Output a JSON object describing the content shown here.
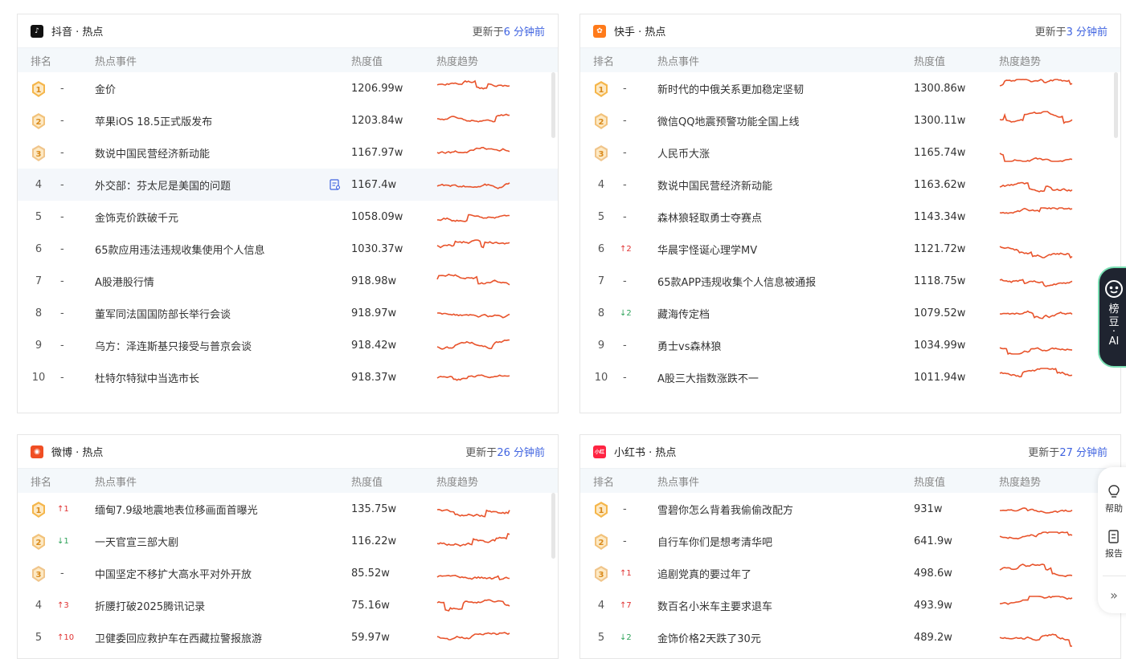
{
  "columns": {
    "rank": "排名",
    "title": "热点事件",
    "value": "热度值",
    "trend": "热度趋势"
  },
  "updated_prefix": "更新于",
  "updated_suffix": " 分钟前",
  "cards": [
    {
      "title": "抖音 · 热点",
      "updated": "6",
      "logo_icon": "douyin-logo-icon",
      "logo_color": "#111111",
      "rows": [
        {
          "rank": "1",
          "change": "-",
          "title": "金价",
          "value": "1206.99w"
        },
        {
          "rank": "2",
          "change": "-",
          "title": "苹果iOS 18.5正式版发布",
          "value": "1203.84w"
        },
        {
          "rank": "3",
          "change": "-",
          "title": "数说中国民营经济新动能",
          "value": "1167.97w"
        },
        {
          "rank": "4",
          "change": "-",
          "title": "外交部：芬太尼是美国的问题",
          "value": "1167.4w"
        },
        {
          "rank": "5",
          "change": "-",
          "title": "金饰克价跌破千元",
          "value": "1058.09w"
        },
        {
          "rank": "6",
          "change": "-",
          "title": "65款应用违法违规收集使用个人信息",
          "value": "1030.37w"
        },
        {
          "rank": "7",
          "change": "-",
          "title": "A股港股行情",
          "value": "918.98w"
        },
        {
          "rank": "8",
          "change": "-",
          "title": "董军同法国国防部长举行会谈",
          "value": "918.97w"
        },
        {
          "rank": "9",
          "change": "-",
          "title": "乌方：泽连斯基只接受与普京会谈",
          "value": "918.42w"
        },
        {
          "rank": "10",
          "change": "-",
          "title": "杜特尔特狱中当选市长",
          "value": "918.37w"
        }
      ]
    },
    {
      "title": "快手 · 热点",
      "updated": "3",
      "logo_icon": "kuaishou-logo-icon",
      "logo_color": "#ff7a1a",
      "rows": [
        {
          "rank": "1",
          "change": "-",
          "title": "新时代的中俄关系更加稳定坚韧",
          "value": "1300.86w"
        },
        {
          "rank": "2",
          "change": "-",
          "title": "微信QQ地震预警功能全国上线",
          "value": "1300.11w"
        },
        {
          "rank": "3",
          "change": "-",
          "title": "人民币大涨",
          "value": "1165.74w"
        },
        {
          "rank": "4",
          "change": "-",
          "title": "数说中国民营经济新动能",
          "value": "1163.62w"
        },
        {
          "rank": "5",
          "change": "-",
          "title": "森林狼轻取勇士夺赛点",
          "value": "1143.34w"
        },
        {
          "rank": "6",
          "change": "↑2",
          "dir": "up",
          "title": "华晨宇怪诞心理学MV",
          "value": "1121.72w"
        },
        {
          "rank": "7",
          "change": "-",
          "title": "65款APP违规收集个人信息被通报",
          "value": "1118.75w"
        },
        {
          "rank": "8",
          "change": "↓2",
          "dir": "down",
          "title": "藏海传定档",
          "value": "1079.52w"
        },
        {
          "rank": "9",
          "change": "-",
          "title": "勇士vs森林狼",
          "value": "1034.99w"
        },
        {
          "rank": "10",
          "change": "-",
          "title": "A股三大指数涨跌不一",
          "value": "1011.94w"
        }
      ]
    },
    {
      "title": "微博 · 热点",
      "updated": "26",
      "logo_icon": "weibo-logo-icon",
      "logo_color": "#f04e23",
      "rows": [
        {
          "rank": "1",
          "change": "↑1",
          "dir": "up",
          "title": "缅甸7.9级地震地表位移画面首曝光",
          "value": "135.75w"
        },
        {
          "rank": "2",
          "change": "↓1",
          "dir": "down",
          "title": "一天官宣三部大剧",
          "value": "116.22w"
        },
        {
          "rank": "3",
          "change": "-",
          "title": "中国坚定不移扩大高水平对外开放",
          "value": "85.52w"
        },
        {
          "rank": "4",
          "change": "↑3",
          "dir": "up",
          "title": "折腰打破2025腾讯记录",
          "value": "75.16w"
        },
        {
          "rank": "5",
          "change": "↑10",
          "dir": "up",
          "title": "卫健委回应救护车在西藏拉警报旅游",
          "value": "59.97w"
        }
      ]
    },
    {
      "title": "小红书 · 热点",
      "updated": "27",
      "logo_icon": "xiaohongshu-logo-icon",
      "logo_color": "#ff2442",
      "rows": [
        {
          "rank": "1",
          "change": "-",
          "title": "雪碧你怎么背着我偷偷改配方",
          "value": "931w"
        },
        {
          "rank": "2",
          "change": "-",
          "title": "自行车你们是想考清华吧",
          "value": "641.9w"
        },
        {
          "rank": "3",
          "change": "↑1",
          "dir": "up",
          "title": "追剧党真的要过年了",
          "value": "498.6w"
        },
        {
          "rank": "4",
          "change": "↑7",
          "dir": "up",
          "title": "数百名小米车主要求退车",
          "value": "493.9w"
        },
        {
          "rank": "5",
          "change": "↓2",
          "dir": "down",
          "title": "金饰价格2天跌了30元",
          "value": "489.2w"
        }
      ]
    }
  ],
  "ai_button": {
    "lines": [
      "榜",
      "豆",
      "·",
      "AI"
    ]
  },
  "side_tools": {
    "help": "帮助",
    "report": "报告"
  },
  "colors": {
    "trend": "#e8532b",
    "up": "#e03131",
    "down": "#2fa35a",
    "updated_num": "#3f63e0"
  }
}
